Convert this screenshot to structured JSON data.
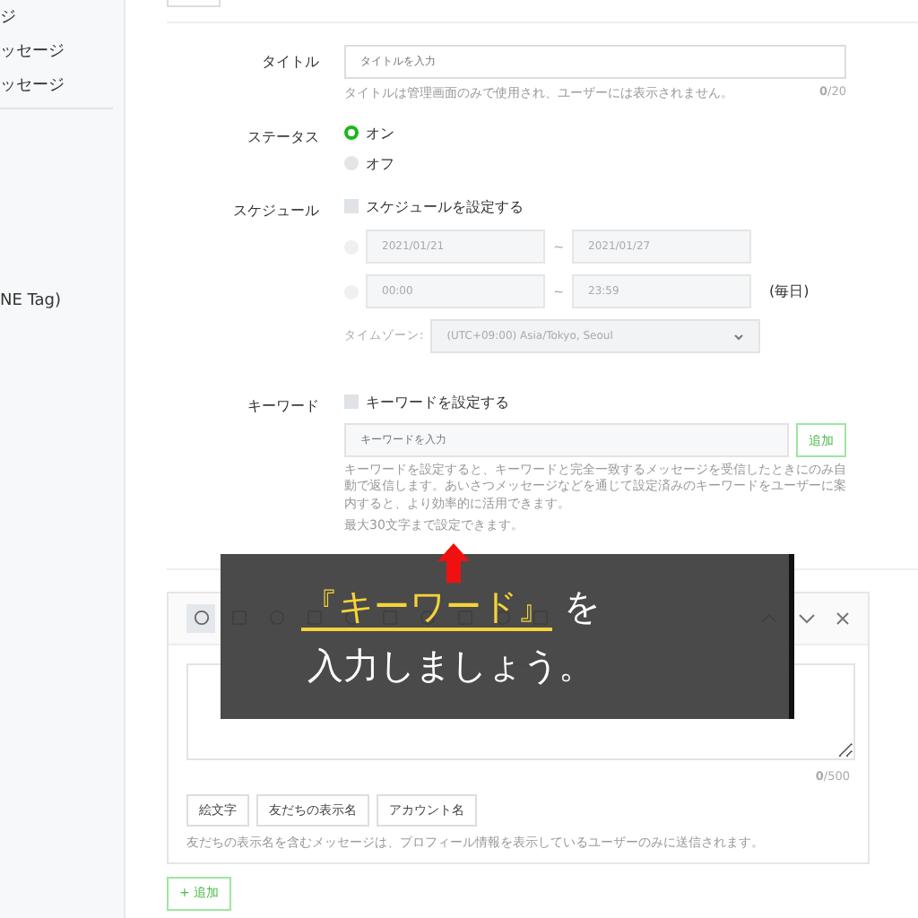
{
  "sidebar": {
    "items": [
      {
        "label": "ジ"
      },
      {
        "label": "ッセージ"
      },
      {
        "label": "ッセージ"
      },
      {
        "label": "NE Tag)"
      }
    ]
  },
  "form": {
    "title": {
      "label": "タイトル",
      "placeholder": "タイトルを入力",
      "help": "タイトルは管理画面のみで使用され、ユーザーには表示されません。",
      "counter_used": "0",
      "counter_max": "/20"
    },
    "status": {
      "label": "ステータス",
      "options": [
        {
          "label": "オン",
          "selected": true
        },
        {
          "label": "オフ",
          "selected": false
        }
      ]
    },
    "schedule": {
      "label": "スケジュール",
      "checkbox": {
        "label": "スケジュールを設定する",
        "checked": false
      },
      "rows": [
        {
          "selected": false,
          "from": "2021/01/21",
          "sep": "~",
          "to": "2021/01/27",
          "suffix": ""
        },
        {
          "selected": false,
          "from": "00:00",
          "sep": "~",
          "to": "23:59",
          "suffix": "(毎日)"
        }
      ],
      "timezone_label": "タイムゾーン:",
      "timezone": "(UTC+09:00) Asia/Tokyo, Seoul"
    },
    "keyword": {
      "label": "キーワード",
      "checkbox": {
        "label": "キーワードを設定する",
        "checked": false
      },
      "placeholder": "キーワードを入力",
      "add_button": "追加",
      "help": [
        "キーワードを設定すると、キーワードと完全一致するメッセージを受信したときにのみ自動で返信します。あいさつメッセージなどを通じて設定済みのキーワードをユーザーに案内すると、より効率的に活用できます。",
        "最大30文字まで設定できます。"
      ]
    }
  },
  "message": {
    "counter_used": "0",
    "counter_max": "/500",
    "buttons": [
      "絵文字",
      "友だちの表示名",
      "アカウント名"
    ],
    "note": "友だちの表示名を含むメッセージは、プロフィール情報を表示しているユーザーのみに送信されます。"
  },
  "add_button": {
    "icon": "+",
    "label": "追加"
  },
  "caption": {
    "highlight": "『キーワード』",
    "rest": "を",
    "line2": "入力しましょう。"
  }
}
